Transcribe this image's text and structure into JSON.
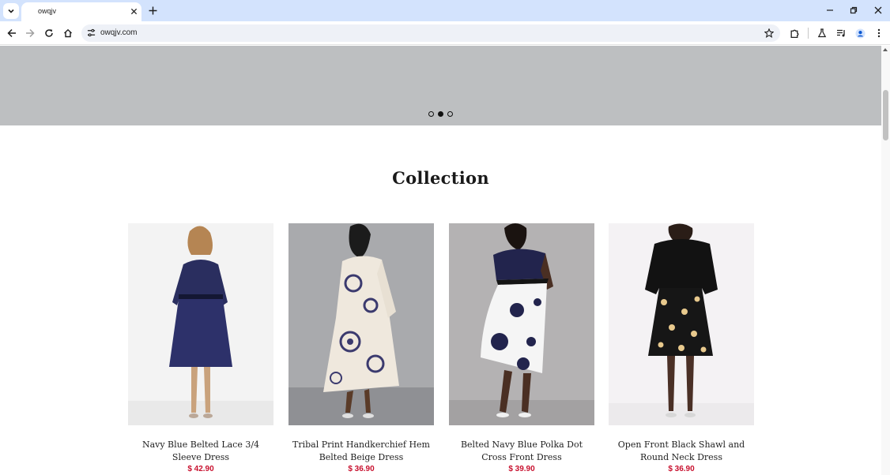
{
  "browser": {
    "tab_title": "owqjv",
    "url": "owqjv.com"
  },
  "hero": {
    "slide_count": 3,
    "active_slide": 2
  },
  "collection": {
    "title": "Collection",
    "products": [
      {
        "name": "Navy Blue Belted Lace 3/4 Sleeve Dress",
        "price": "$ 42.90"
      },
      {
        "name": "Tribal Print Handkerchief Hem Belted Beige Dress",
        "price": "$ 36.90"
      },
      {
        "name": "Belted Navy Blue Polka Dot Cross Front Dress",
        "price": "$ 39.90"
      },
      {
        "name": "Open Front Black Shawl and Round Neck Dress",
        "price": "$ 36.90"
      }
    ]
  },
  "colors": {
    "price": "#c8102e",
    "hero_bg": "#bdbfc1",
    "chrome_tabstrip": "#d3e3fd"
  }
}
